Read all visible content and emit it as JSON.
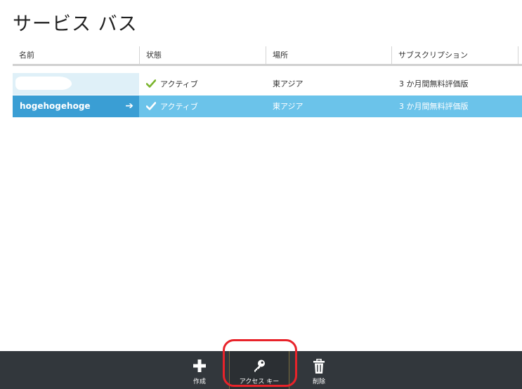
{
  "page": {
    "title": "サービス バス"
  },
  "table": {
    "columns": [
      "名前",
      "状態",
      "場所",
      "サブスクリプション"
    ],
    "rows": [
      {
        "name": "",
        "status": "アクティブ",
        "location": "東アジア",
        "subscription": "3 か月間無料評価版",
        "selected": false
      },
      {
        "name": "hogehogehoge",
        "status": "アクティブ",
        "location": "東アジア",
        "subscription": "3 か月間無料評価版",
        "selected": true
      }
    ]
  },
  "commands": [
    {
      "label": "作成",
      "icon": "plus-icon"
    },
    {
      "label": "アクセス キー",
      "icon": "key-icon"
    },
    {
      "label": "削除",
      "icon": "trash-icon"
    }
  ],
  "colors": {
    "selected_row": "#6bc3ea",
    "selected_name_cell": "#3a9ed4",
    "hover_row_name": "#dff0f8",
    "check_green": "#7ab42c",
    "command_bar": "#32373c",
    "highlight": "#e8232a"
  }
}
